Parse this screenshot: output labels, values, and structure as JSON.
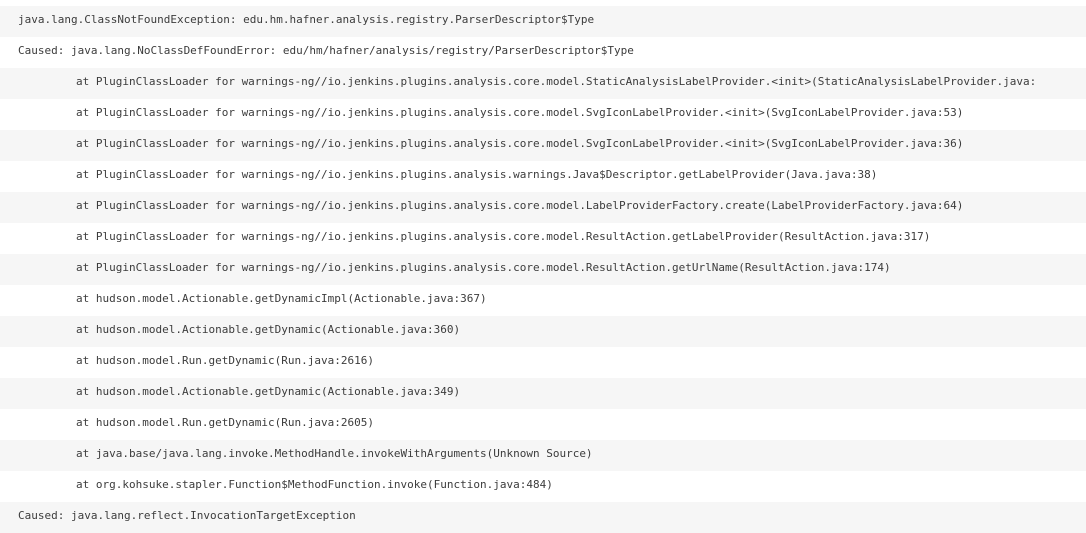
{
  "stack_trace": {
    "lines": [
      "java.lang.ClassNotFoundException: edu.hm.hafner.analysis.registry.ParserDescriptor$Type",
      "Caused: java.lang.NoClassDefFoundError: edu/hm/hafner/analysis/registry/ParserDescriptor$Type",
      "at PluginClassLoader for warnings-ng//io.jenkins.plugins.analysis.core.model.StaticAnalysisLabelProvider.<init>(StaticAnalysisLabelProvider.java:",
      "at PluginClassLoader for warnings-ng//io.jenkins.plugins.analysis.core.model.SvgIconLabelProvider.<init>(SvgIconLabelProvider.java:53)",
      "at PluginClassLoader for warnings-ng//io.jenkins.plugins.analysis.core.model.SvgIconLabelProvider.<init>(SvgIconLabelProvider.java:36)",
      "at PluginClassLoader for warnings-ng//io.jenkins.plugins.analysis.warnings.Java$Descriptor.getLabelProvider(Java.java:38)",
      "at PluginClassLoader for warnings-ng//io.jenkins.plugins.analysis.core.model.LabelProviderFactory.create(LabelProviderFactory.java:64)",
      "at PluginClassLoader for warnings-ng//io.jenkins.plugins.analysis.core.model.ResultAction.getLabelProvider(ResultAction.java:317)",
      "at PluginClassLoader for warnings-ng//io.jenkins.plugins.analysis.core.model.ResultAction.getUrlName(ResultAction.java:174)",
      "at hudson.model.Actionable.getDynamicImpl(Actionable.java:367)",
      "at hudson.model.Actionable.getDynamic(Actionable.java:360)",
      "at hudson.model.Run.getDynamic(Run.java:2616)",
      "at hudson.model.Actionable.getDynamic(Actionable.java:349)",
      "at hudson.model.Run.getDynamic(Run.java:2605)",
      "at java.base/java.lang.invoke.MethodHandle.invokeWithArguments(Unknown Source)",
      "at org.kohsuke.stapler.Function$MethodFunction.invoke(Function.java:484)",
      "Caused: java.lang.reflect.InvocationTargetException"
    ]
  },
  "colors": {
    "text": "#3c3c3c",
    "row_shaded": "#f6f6f6",
    "row_plain": "#ffffff"
  }
}
